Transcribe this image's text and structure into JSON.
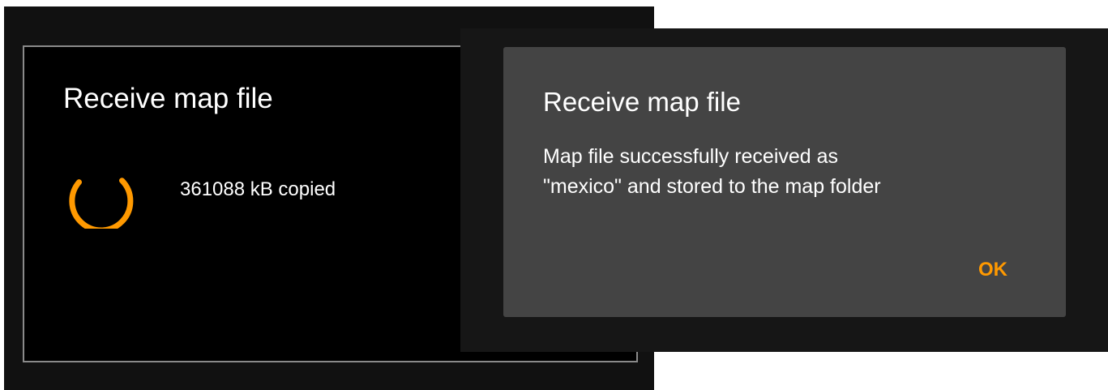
{
  "left_dialog": {
    "title": "Receive map file",
    "progress_text": "361088 kB copied"
  },
  "right_dialog": {
    "title": "Receive map file",
    "message_line1": "Map file successfully received as",
    "message_line2": "\"mexico\" and stored to the map folder",
    "ok_label": "OK"
  },
  "colors": {
    "accent": "#ff9900",
    "left_dialog_bg": "#000000",
    "right_dialog_bg": "#444444"
  },
  "icons": {
    "spinner": "loading-spinner-icon"
  }
}
